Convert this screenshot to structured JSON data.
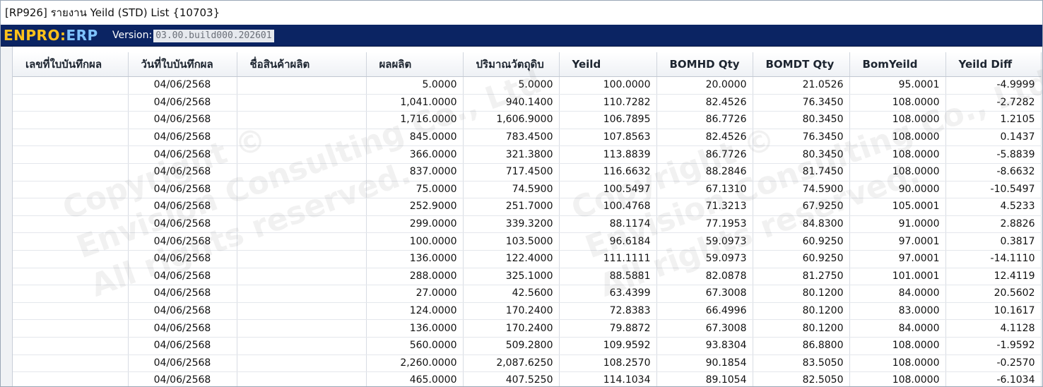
{
  "window": {
    "title": "[RP926] รายงาน Yeild (STD) List {10703}"
  },
  "header": {
    "logo_part1": "ENPRO",
    "logo_sep": ":",
    "logo_part2": "ERP",
    "version_label": "Version:",
    "version_value": "03.00.build000.202601"
  },
  "watermark": {
    "left": [
      "Copyright ©",
      "Envision Consulting Co., Ltd",
      "All rights reserved."
    ],
    "right": [
      "Copyright ©",
      "Envision Consulting Co., Ltd",
      "All rights reserved."
    ]
  },
  "grid": {
    "columns": [
      "เลขที่ใบบันทึกผล",
      "วันที่ใบบันทึกผล",
      "ชื่อสินค้าผลิต",
      "ผลผลิต",
      "ปริมาณวัตถุดิบ",
      "Yeild",
      "BOMHD Qty",
      "BOMDT Qty",
      "BomYeild",
      "Yeild Diff"
    ],
    "rows": [
      [
        "",
        "04/06/2568",
        "",
        "5.0000",
        "5.0000",
        "100.0000",
        "20.0000",
        "21.0526",
        "95.0001",
        "-4.9999"
      ],
      [
        "",
        "04/06/2568",
        "",
        "1,041.0000",
        "940.1400",
        "110.7282",
        "82.4526",
        "76.3450",
        "108.0000",
        "-2.7282"
      ],
      [
        "",
        "04/06/2568",
        "",
        "1,716.0000",
        "1,606.9000",
        "106.7895",
        "86.7726",
        "80.3450",
        "108.0000",
        "1.2105"
      ],
      [
        "",
        "04/06/2568",
        "",
        "845.0000",
        "783.4500",
        "107.8563",
        "82.4526",
        "76.3450",
        "108.0000",
        "0.1437"
      ],
      [
        "",
        "04/06/2568",
        "",
        "366.0000",
        "321.3800",
        "113.8839",
        "86.7726",
        "80.3450",
        "108.0000",
        "-5.8839"
      ],
      [
        "",
        "04/06/2568",
        "",
        "837.0000",
        "717.4500",
        "116.6632",
        "88.2846",
        "81.7450",
        "108.0000",
        "-8.6632"
      ],
      [
        "",
        "04/06/2568",
        "",
        "75.0000",
        "74.5900",
        "100.5497",
        "67.1310",
        "74.5900",
        "90.0000",
        "-10.5497"
      ],
      [
        "",
        "04/06/2568",
        "",
        "252.9000",
        "251.7000",
        "100.4768",
        "71.3213",
        "67.9250",
        "105.0001",
        "4.5233"
      ],
      [
        "",
        "04/06/2568",
        "",
        "299.0000",
        "339.3200",
        "88.1174",
        "77.1953",
        "84.8300",
        "91.0000",
        "2.8826"
      ],
      [
        "",
        "04/06/2568",
        "",
        "100.0000",
        "103.5000",
        "96.6184",
        "59.0973",
        "60.9250",
        "97.0001",
        "0.3817"
      ],
      [
        "",
        "04/06/2568",
        "",
        "136.0000",
        "122.4000",
        "111.1111",
        "59.0973",
        "60.9250",
        "97.0001",
        "-14.1110"
      ],
      [
        "",
        "04/06/2568",
        "",
        "288.0000",
        "325.1000",
        "88.5881",
        "82.0878",
        "81.2750",
        "101.0001",
        "12.4119"
      ],
      [
        "",
        "04/06/2568",
        "",
        "27.0000",
        "42.5600",
        "63.4399",
        "67.3008",
        "80.1200",
        "84.0000",
        "20.5602"
      ],
      [
        "",
        "04/06/2568",
        "",
        "124.0000",
        "170.2400",
        "72.8383",
        "66.4996",
        "80.1200",
        "83.0000",
        "10.1617"
      ],
      [
        "",
        "04/06/2568",
        "",
        "136.0000",
        "170.2400",
        "79.8872",
        "67.3008",
        "80.1200",
        "84.0000",
        "4.1128"
      ],
      [
        "",
        "04/06/2568",
        "",
        "560.0000",
        "509.2800",
        "109.9592",
        "93.8304",
        "86.8800",
        "108.0000",
        "-1.9592"
      ],
      [
        "",
        "04/06/2568",
        "",
        "2,260.0000",
        "2,087.6250",
        "108.2570",
        "90.1854",
        "83.5050",
        "108.0000",
        "-0.2570"
      ],
      [
        "",
        "04/06/2568",
        "",
        "465.0000",
        "407.5250",
        "114.1034",
        "89.1054",
        "82.5050",
        "108.0000",
        "-6.1034"
      ]
    ]
  },
  "colors": {
    "header_bg": "#0b2463",
    "logo_orange": "#ffc21a",
    "logo_blue": "#7fc3ff"
  }
}
